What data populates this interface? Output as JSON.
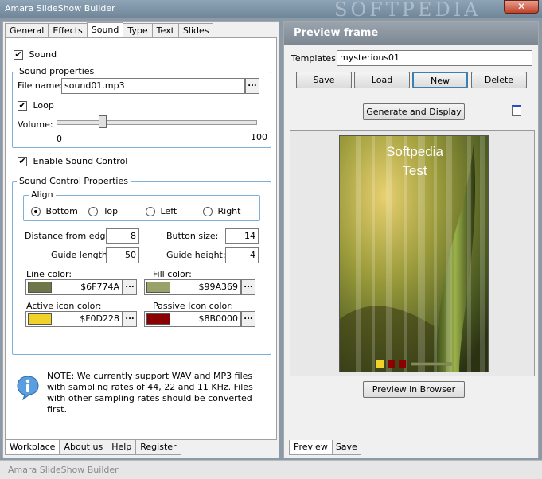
{
  "window": {
    "title": "Amara SlideShow Builder",
    "watermark": "SOFTPEDIA",
    "close_label": "✕"
  },
  "left_tabs": [
    "General",
    "Effects",
    "Sound",
    "Type",
    "Text",
    "Slides"
  ],
  "left_active_tab": "Sound",
  "sound": {
    "sound_label": "Sound",
    "sound_checked": true,
    "sound_properties_label": "Sound properties",
    "file_name_label": "File name:",
    "file_name_value": "sound01.mp3",
    "browse_label": "...",
    "loop_label": "Loop",
    "loop_checked": true,
    "volume_label": "Volume:",
    "volume_min": "0",
    "volume_max": "100",
    "volume_value": 0.22,
    "enable_sound_control_label": "Enable Sound Control",
    "enable_sound_control_checked": true
  },
  "control": {
    "group_label": "Sound Control  Properties",
    "align_label": "Align",
    "align_options": [
      "Bottom",
      "Top",
      "Left",
      "Right"
    ],
    "align_selected": "Bottom",
    "distance_label": "Distance from edge:",
    "distance_value": "8",
    "button_size_label": "Button size:",
    "button_size_value": "14",
    "guide_length_label": "Guide length:",
    "guide_length_value": "50",
    "guide_height_label": "Guide height:",
    "guide_height_value": "4",
    "line_color_label": "Line color:",
    "line_color_value": "$6F774A",
    "line_color_hex": "#4A776F",
    "fill_color_label": "Fill color:",
    "fill_color_value": "$99A369",
    "fill_color_hex": "#69A399",
    "active_icon_label": "Active icon color:",
    "active_icon_value": "$F0D228",
    "active_icon_hex": "#28D2F0",
    "passive_icon_label": "Passive Icon color:",
    "passive_icon_value": "$8B0000",
    "passive_icon_hex": "#00008B"
  },
  "note": "NOTE: We currently support WAV and MP3 files with sampling rates of 44, 22 and 11 KHz. Files with other sampling rates should be converted first.",
  "left_bottom_tabs": [
    "Workplace",
    "About us",
    "Help",
    "Register"
  ],
  "status": "Amara SlideShow Builder",
  "preview": {
    "header": "Preview frame",
    "templates_label": "Templates:",
    "templates_value": "mysterious01",
    "buttons": [
      "Save",
      "Load",
      "New",
      "Delete"
    ],
    "generate_label": "Generate and Display",
    "slide_title_1": "Softpedia",
    "slide_title_2": "Test",
    "browser_label": "Preview in Browser"
  },
  "right_bottom_tabs": [
    "Preview",
    "Save"
  ]
}
